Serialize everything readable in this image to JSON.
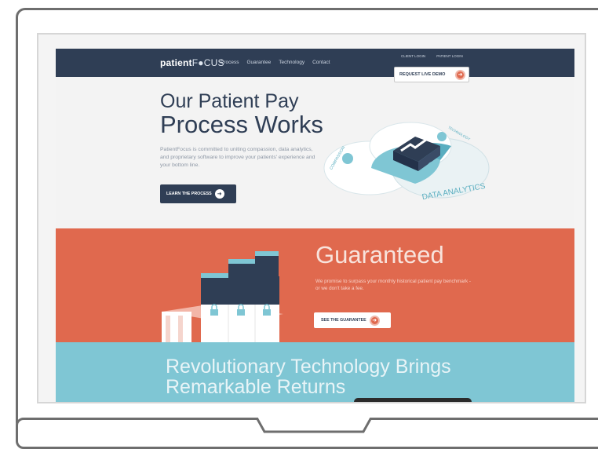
{
  "nav": {
    "logo_main": "patient",
    "logo_focus": "F●CUS",
    "links": [
      "Process",
      "Guarantee",
      "Technology",
      "Contact"
    ],
    "client_login": "CLIENT LOGIN",
    "patient_login": "PATIENT LOGIN",
    "demo_label": "REQUEST LIVE DEMO"
  },
  "hero": {
    "title_line1": "Our Patient Pay",
    "title_line2": "Process Works",
    "text": "PatientFocus is committed to uniting compassion, data analytics, and proprietary software to improve your patients' experience and your bottom line.",
    "button": "LEARN THE PROCESS",
    "graphic_labels": {
      "data_analytics": "DATA ANALYTICS",
      "compassion": "COMPASSION",
      "technology": "TECHNOLOGY"
    }
  },
  "guarantee": {
    "title": "Guaranteed",
    "text": "We promise to surpass your monthly historical patient pay benchmark - or we don't take a fee.",
    "button": "SEE THE GUARANTEE"
  },
  "technology": {
    "title_line1": "Revolutionary Technology Brings",
    "title_line2": "Remarkable Returns"
  },
  "colors": {
    "navy": "#2f3e55",
    "orange": "#e0694e",
    "teal": "#7fc6d4",
    "hero_bg": "#f3f3f3"
  },
  "icons": [
    "arrow-right-icon",
    "lock-icon",
    "chart-icon"
  ]
}
